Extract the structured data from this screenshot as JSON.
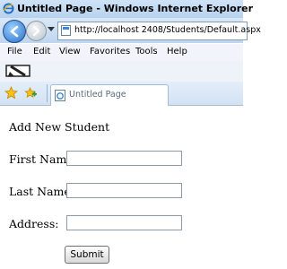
{
  "window": {
    "title": "Untitled Page - Windows Internet Explorer"
  },
  "navigation": {
    "url": "http://localhost 2408/Students/Default.aspx"
  },
  "menu": {
    "items": [
      "File",
      "Edit",
      "View",
      "Favorites",
      "Tools",
      "Help"
    ]
  },
  "tab": {
    "label": "Untitled Page"
  },
  "form": {
    "heading": "Add New Student",
    "first_name_label": "First Name:",
    "first_name_value": "",
    "last_name_label": "Last Name:",
    "last_name_value": "",
    "address_label": "Address:",
    "address_value": "",
    "submit_label": "Submit"
  }
}
